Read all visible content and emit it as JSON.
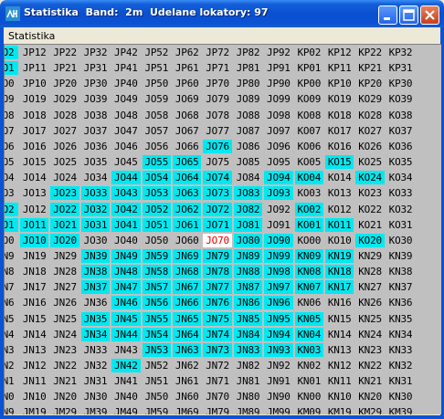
{
  "window": {
    "title": "Statistika  Band:  2m  Udelane lokatory: 97",
    "icon": "app-icon",
    "controls": [
      "minimize-icon",
      "maximize-icon",
      "close-icon"
    ]
  },
  "menu": {
    "items": [
      "Statistika"
    ]
  },
  "colors": {
    "highlight": "#00e8f0",
    "selected_bg": "#ffffff",
    "selected_text": "#e00000",
    "grid_bg": "#c0c0c0"
  },
  "grid": {
    "rows": [
      [
        "O2",
        "JP12",
        "JP22",
        "JP32",
        "JP42",
        "JP52",
        "JP62",
        "JP72",
        "JP82",
        "JP92",
        "KP02",
        "KP12",
        "KP22",
        "KP32"
      ],
      [
        "O1",
        "JP11",
        "JP21",
        "JP31",
        "JP41",
        "JP51",
        "JP61",
        "JP71",
        "JP81",
        "JP91",
        "KP01",
        "KP11",
        "KP21",
        "KP31"
      ],
      [
        "O0",
        "JP10",
        "JP20",
        "JP30",
        "JP40",
        "JP50",
        "JP60",
        "JP70",
        "JP80",
        "JP90",
        "KP00",
        "KP10",
        "KP20",
        "KP30"
      ],
      [
        "O9",
        "JO19",
        "JO29",
        "JO39",
        "JO49",
        "JO59",
        "JO69",
        "JO79",
        "JO89",
        "JO99",
        "KO09",
        "KO19",
        "KO29",
        "KO39"
      ],
      [
        "O8",
        "JO18",
        "JO28",
        "JO38",
        "JO48",
        "JO58",
        "JO68",
        "JO78",
        "JO88",
        "JO98",
        "KO08",
        "KO18",
        "KO28",
        "KO38"
      ],
      [
        "O7",
        "JO17",
        "JO27",
        "JO37",
        "JO47",
        "JO57",
        "JO67",
        "JO77",
        "JO87",
        "JO97",
        "KO07",
        "KO17",
        "KO27",
        "KO37"
      ],
      [
        "O6",
        "JO16",
        "JO26",
        "JO36",
        "JO46",
        "JO56",
        "JO66",
        "JO76",
        "JO86",
        "JO96",
        "KO06",
        "KO16",
        "KO26",
        "KO36"
      ],
      [
        "O5",
        "JO15",
        "JO25",
        "JO35",
        "JO45",
        "JO55",
        "JO65",
        "JO75",
        "JO85",
        "JO95",
        "KO05",
        "KO15",
        "KO25",
        "KO35"
      ],
      [
        "O4",
        "JO14",
        "JO24",
        "JO34",
        "JO44",
        "JO54",
        "JO64",
        "JO74",
        "JO84",
        "JO94",
        "KO04",
        "KO14",
        "KO24",
        "KO34"
      ],
      [
        "O3",
        "JO13",
        "JO23",
        "JO33",
        "JO43",
        "JO53",
        "JO63",
        "JO73",
        "JO83",
        "JO93",
        "KO03",
        "KO13",
        "KO23",
        "KO33"
      ],
      [
        "O2",
        "JO12",
        "JO22",
        "JO32",
        "JO42",
        "JO52",
        "JO62",
        "JO72",
        "JO82",
        "JO92",
        "KO02",
        "KO12",
        "KO22",
        "KO32"
      ],
      [
        "O1",
        "JO11",
        "JO21",
        "JO31",
        "JO41",
        "JO51",
        "JO61",
        "JO71",
        "JO81",
        "JO91",
        "KO01",
        "KO11",
        "KO21",
        "KO31"
      ],
      [
        "O0",
        "JO10",
        "JO20",
        "JO30",
        "JO40",
        "JO50",
        "JO60",
        "JO70",
        "JO80",
        "JO90",
        "KO00",
        "KO10",
        "KO20",
        "KO30"
      ],
      [
        "N9",
        "JN19",
        "JN29",
        "JN39",
        "JN49",
        "JN59",
        "JN69",
        "JN79",
        "JN89",
        "JN99",
        "KN09",
        "KN19",
        "KN29",
        "KN39"
      ],
      [
        "N8",
        "JN18",
        "JN28",
        "JN38",
        "JN48",
        "JN58",
        "JN68",
        "JN78",
        "JN88",
        "JN98",
        "KN08",
        "KN18",
        "KN28",
        "KN38"
      ],
      [
        "N7",
        "JN17",
        "JN27",
        "JN37",
        "JN47",
        "JN57",
        "JN67",
        "JN77",
        "JN87",
        "JN97",
        "KN07",
        "KN17",
        "KN27",
        "KN37"
      ],
      [
        "N6",
        "JN16",
        "JN26",
        "JN36",
        "JN46",
        "JN56",
        "JN66",
        "JN76",
        "JN86",
        "JN96",
        "KN06",
        "KN16",
        "KN26",
        "KN36"
      ],
      [
        "N5",
        "JN15",
        "JN25",
        "JN35",
        "JN45",
        "JN55",
        "JN65",
        "JN75",
        "JN85",
        "JN95",
        "KN05",
        "KN15",
        "KN25",
        "KN35"
      ],
      [
        "N4",
        "JN14",
        "JN24",
        "JN34",
        "JN44",
        "JN54",
        "JN64",
        "JN74",
        "JN84",
        "JN94",
        "KN04",
        "KN14",
        "KN24",
        "KN34"
      ],
      [
        "N3",
        "JN13",
        "JN23",
        "JN33",
        "JN43",
        "JN53",
        "JN63",
        "JN73",
        "JN83",
        "JN93",
        "KN03",
        "KN13",
        "KN23",
        "KN33"
      ],
      [
        "N2",
        "JN12",
        "JN22",
        "JN32",
        "JN42",
        "JN52",
        "JN62",
        "JN72",
        "JN82",
        "JN92",
        "KN02",
        "KN12",
        "KN22",
        "KN32"
      ],
      [
        "N1",
        "JN11",
        "JN21",
        "JN31",
        "JN41",
        "JN51",
        "JN61",
        "JN71",
        "JN81",
        "JN91",
        "KN01",
        "KN11",
        "KN21",
        "KN31"
      ],
      [
        "N0",
        "JN10",
        "JN20",
        "JN30",
        "JN40",
        "JN50",
        "JN60",
        "JN70",
        "JN80",
        "JN90",
        "KN00",
        "KN10",
        "KN20",
        "KN30"
      ],
      [
        "N9",
        "JM19",
        "JM29",
        "JM39",
        "JM49",
        "JM59",
        "JM69",
        "JM79",
        "JM89",
        "JM99",
        "KM09",
        "KM19",
        "KM29",
        "KM39"
      ]
    ],
    "highlighted": [
      "KO15",
      "JO55",
      "JO65",
      "JO76",
      "JO44",
      "JO54",
      "JO64",
      "JO74",
      "JO94",
      "KO04",
      "KO24",
      "JO23",
      "JO33",
      "JO43",
      "JO53",
      "JO63",
      "JO73",
      "JO83",
      "JO93",
      "O2",
      "JO22",
      "JO32",
      "JO42",
      "JO52",
      "JO62",
      "JO72",
      "JO82",
      "KO02",
      "O1",
      "JO11",
      "JO21",
      "JO31",
      "JO41",
      "JO51",
      "JO61",
      "JO71",
      "JO81",
      "KO01",
      "KO11",
      "JO10",
      "JO20",
      "JO80",
      "JO90",
      "KO20",
      "JN39",
      "JN49",
      "JN59",
      "JN69",
      "JN79",
      "JN89",
      "JN99",
      "KN09",
      "KN19",
      "JN38",
      "JN48",
      "JN58",
      "JN68",
      "JN78",
      "JN88",
      "JN98",
      "KN08",
      "KN18",
      "JN37",
      "JN47",
      "JN57",
      "JN67",
      "JN77",
      "JN87",
      "JN97",
      "KN07",
      "KN17",
      "JN46",
      "JN56",
      "JN66",
      "JN76",
      "JN86",
      "JN96",
      "JN35",
      "JN45",
      "JN55",
      "JN65",
      "JN75",
      "JN85",
      "JN95",
      "KN05",
      "JN34",
      "JN44",
      "JN54",
      "JN64",
      "JN74",
      "JN84",
      "JN94",
      "KN04",
      "JN53",
      "JN63",
      "JN73",
      "JN83",
      "JN93",
      "KN03",
      "JN42"
    ],
    "selected": "JO70"
  }
}
